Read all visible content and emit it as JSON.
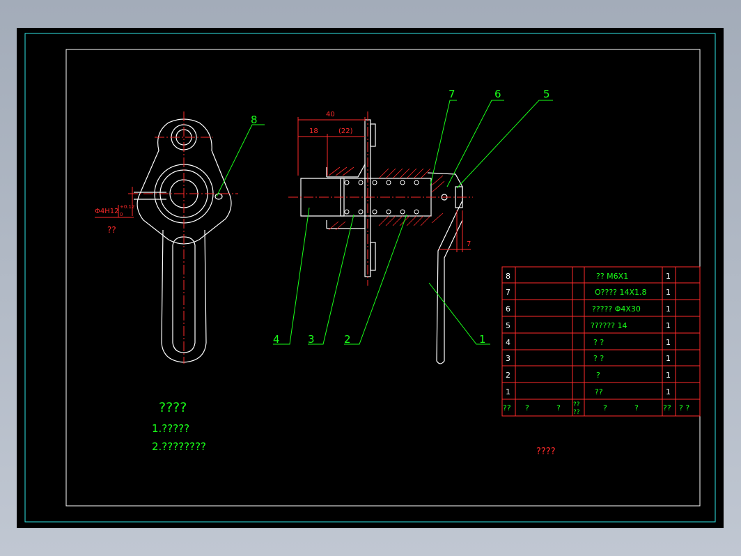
{
  "balloons": {
    "b1": "1",
    "b2": "2",
    "b3": "3",
    "b4": "4",
    "b5": "5",
    "b6": "6",
    "b7": "7",
    "b8": "8"
  },
  "dimensions": {
    "d40": "40",
    "d18": "18",
    "d22": "(22)",
    "d7": "7",
    "fit_main": "Φ4H12",
    "fit_upper": "+0.12",
    "fit_lower": "0",
    "fit_note": "??"
  },
  "notes": {
    "title": "????",
    "line1": "1.?????",
    "line2": "2.????????"
  },
  "parts_list": {
    "rows": [
      {
        "no": "8",
        "name": "?? M6X1",
        "qty": "1"
      },
      {
        "no": "7",
        "name": "O????  14X1.8",
        "qty": "1"
      },
      {
        "no": "6",
        "name": "?????  Φ4X30",
        "qty": "1"
      },
      {
        "no": "5",
        "name": "??????  14",
        "qty": "1"
      },
      {
        "no": "4",
        "name": "? ?",
        "qty": "1"
      },
      {
        "no": "3",
        "name": "? ?",
        "qty": "1"
      },
      {
        "no": "2",
        "name": "?",
        "qty": "1"
      },
      {
        "no": "1",
        "name": "??",
        "qty": "1"
      }
    ],
    "header": {
      "no": "??",
      "code_a": "?",
      "code_b": "?",
      "name_top": "??",
      "name_bottom": "??",
      "name_a": "?",
      "name_b": "?",
      "qty": "??",
      "extra": "? ?"
    }
  },
  "sheet_label": "????",
  "colors": {
    "line_green": "#19ff19",
    "line_red": "#ff2a2a",
    "line_white": "#ffffff",
    "frame_cyan": "#2fe6e6"
  }
}
